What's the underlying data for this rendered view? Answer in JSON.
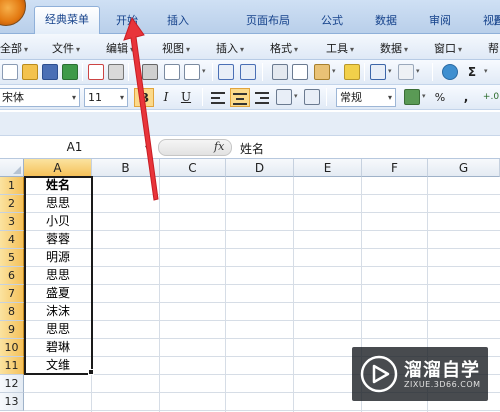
{
  "ribbon": {
    "tabs": [
      "经典菜单",
      "开始",
      "插入",
      "页面布局",
      "公式",
      "数据",
      "审阅",
      "视图",
      "开"
    ],
    "active_tab": "经典菜单"
  },
  "menubar": {
    "items": [
      "全部",
      "文件",
      "编辑",
      "视图",
      "插入",
      "格式",
      "工具",
      "数据",
      "窗口",
      "帮"
    ]
  },
  "toolbar": {
    "font_name": "宋体",
    "font_size": "11",
    "bold": "B",
    "italic": "I",
    "underline": "U",
    "number_format": "常规",
    "sum_icon": "Σ",
    "percent": "%",
    "comma": ",",
    "decimal": "+.0"
  },
  "formula_bar": {
    "name_box": "A1",
    "fx": "fx",
    "content": "姓名"
  },
  "sheet": {
    "columns": [
      "A",
      "B",
      "C",
      "D",
      "E",
      "F",
      "G"
    ],
    "rows": [
      "1",
      "2",
      "3",
      "4",
      "5",
      "6",
      "7",
      "8",
      "9",
      "10",
      "11",
      "12",
      "13"
    ],
    "column_a": [
      "姓名",
      "思思",
      "小贝",
      "蓉蓉",
      "明源",
      "思思",
      "盛夏",
      "沫沫",
      "思思",
      "碧琳",
      "文维"
    ]
  },
  "watermark": {
    "title": "溜溜自学",
    "url": "ZIXUE.3D66.COM"
  },
  "colors": {
    "ribbon_text": "#15428b",
    "selected_header": "#f5c15a",
    "annotation_arrow": "#e8343a"
  }
}
